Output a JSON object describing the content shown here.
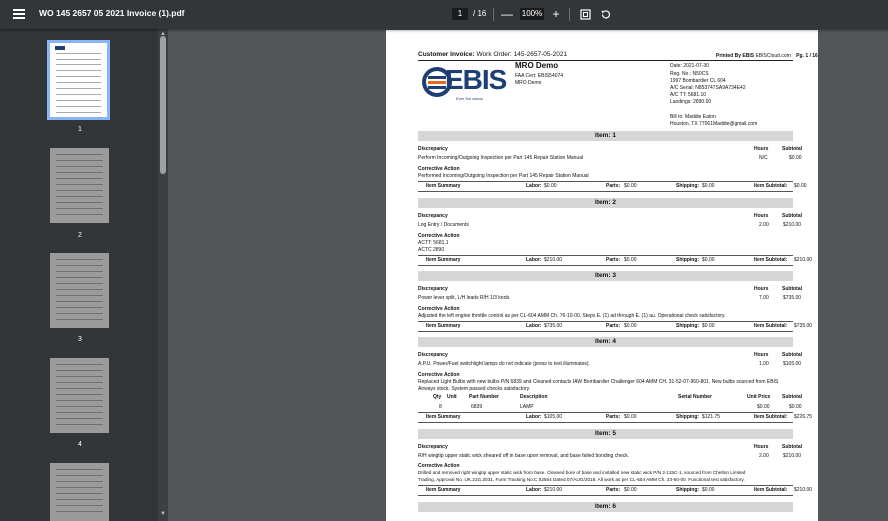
{
  "toolbar": {
    "title": "WO 145 2657 05 2021 Invoice (1).pdf",
    "page_current": "1",
    "page_total": "/ 16",
    "zoom": "100%",
    "zoom_out": "—",
    "zoom_in": "+"
  },
  "sidebar": {
    "thumbnails": [
      {
        "num": "1"
      },
      {
        "num": "2"
      },
      {
        "num": "3"
      },
      {
        "num": "4"
      }
    ]
  },
  "invoice": {
    "heading_label": "Customer Invoice:",
    "heading_value": "Work Order: 145-2657-05-2021",
    "printed_by": "Printed By EBIS",
    "printed_site": "EBISCloud.com",
    "page_label": "Pg. 1 / 16",
    "logo_text": "EBIS",
    "logo_sub": "Ever Sol utions",
    "company_name": "MRO Demo",
    "faa_cert": "FAA Cert: EBIS54074",
    "company_line": "MRO Demo",
    "date": "Date: 2021-07-30",
    "reg": "Reg. No.: N50CS",
    "aircraft": "1997 Bombardier CL 604",
    "ac_serial": "A/C Serial: N853747SA9A734E42",
    "ac_tt": "A/C TT: 5681.10",
    "landings": "Landings: 2890.00",
    "bill_to": "Bill to: Maddie Eaton",
    "bill_addr": "Houston, TX 77061Maddie@gmail.com",
    "labels": {
      "discrepancy": "Discrepancy",
      "corrective": "Corrective Action",
      "hours": "Hours",
      "subtotal": "Subtotal",
      "item_summary": "Item Summary",
      "labor": "Labor:",
      "parts": "Parts:",
      "shipping": "Shipping:",
      "item_subtotal": "Item Subtotal:",
      "qty": "Qty",
      "unit": "Unit",
      "part_number": "Part Number",
      "description": "Description",
      "serial_number": "Serial Number",
      "unit_price": "Unit Price"
    },
    "items": [
      {
        "header": "Item: 1",
        "discrepancy": "Perform Incoming/Outgoing Inspection per Part 145 Repair Station Manual",
        "hours": "N/C",
        "subtotal": "$0.00",
        "corrective": [
          "Performed Incoming/Outgoing Inspection per Part 145 Repair Station Manual"
        ],
        "labor": "$0.00",
        "parts": "$0.00",
        "shipping": "$0.00",
        "item_subtotal": "$0.00"
      },
      {
        "header": "Item: 2",
        "discrepancy": "Log Entry / Documents",
        "hours": "2.00",
        "subtotal": "$210.00",
        "corrective": [
          "ACTT: 5681.1",
          "ACTC 2890"
        ],
        "labor": "$210.00",
        "parts": "$0.00",
        "shipping": "$0.00",
        "item_subtotal": "$210.00"
      },
      {
        "header": "Item: 3",
        "discrepancy": "Power lever split, L/H leads R/H 1/3 knob.",
        "hours": "7.00",
        "subtotal": "$735.00",
        "corrective": [
          "Adjusted the left engine throttle control as per CL-604 AMM Ch. 76-10-00, Steps E. (1) ad through E. (1) au. Operational check satisfactory."
        ],
        "labor": "$735.00",
        "parts": "$0.00",
        "shipping": "$0.00",
        "item_subtotal": "$735.00"
      },
      {
        "header": "Item: 4",
        "discrepancy": "A.P.U. Power/Fuel switchlight lamps do not indicate (press to test illuminates).",
        "hours": "1.00",
        "subtotal": "$105.00",
        "corrective": [
          "Replaced Light Bulbs with new bulbs P/N 6839 and Cleaned contacts IAW Bombardier Challenger 604 AMM CH. 31-52-07-960-801. New bulbs sourced from EBIS",
          "Airways stock. System passed checks satisfactory."
        ],
        "part": {
          "qty": "8",
          "number": "6839",
          "description": "LAMP",
          "unit_price": "$0.00",
          "subtotal": "$0.00"
        },
        "labor": "$105.00",
        "parts": "$0.00",
        "shipping": "$121.75",
        "item_subtotal": "$226.75"
      },
      {
        "header": "Item: 5",
        "discrepancy": "R/H wingtip upper static wick sheared off in base upon removal, and base failed bonding check.",
        "hours": "2.00",
        "subtotal": "$210.00",
        "corrective": [
          "Drilled and removed right wingtip upper static wick from base. Cleaned bore of base and installed new static wick P/N 2-115C-1, sourced from Chelton Limited",
          "Trading, Approval No. UK.21G.2031, Form Tracking No:C 52564 Dated 07/AUG/2018. All work as per CL-604 AMM Ch. 23-60-00. Functional test satisfactory."
        ],
        "labor": "$210.00",
        "parts": "$0.00",
        "shipping": "$0.00",
        "item_subtotal": "$210.00"
      },
      {
        "header": "Item: 6"
      }
    ]
  },
  "colors": {
    "toolbar": "#323639",
    "sidebar": "#323639",
    "viewer_bg": "#525659",
    "thumb_selected_border": "#8ab4f8",
    "item_header_bg": "#d6d6d6",
    "logo_blue": "#1f3e73",
    "logo_orange": "#e36c1b"
  }
}
